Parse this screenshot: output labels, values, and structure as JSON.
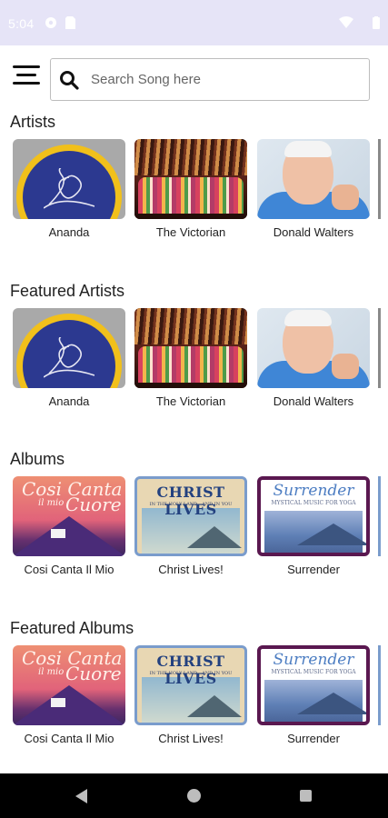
{
  "status_bar": {
    "time": "5:04",
    "icons": [
      "media-icon",
      "sim-icon",
      "wifi-icon",
      "battery-icon"
    ]
  },
  "search": {
    "placeholder": "Search Song here",
    "value": ""
  },
  "sections": {
    "artists": {
      "title": "Artists",
      "items": [
        {
          "label": "Ananda",
          "art": "ananda-logo"
        },
        {
          "label": "The Victorian",
          "art": "choir-photo"
        },
        {
          "label": "Donald Walters",
          "art": "portrait-photo"
        }
      ]
    },
    "featured_artists": {
      "title": "Featured Artists",
      "items": [
        {
          "label": "Ananda",
          "art": "ananda-logo"
        },
        {
          "label": "The Victorian",
          "art": "choir-photo"
        },
        {
          "label": "Donald Walters",
          "art": "portrait-photo"
        }
      ]
    },
    "albums": {
      "title": "Albums",
      "items": [
        {
          "label": "Cosi Canta Il Mio",
          "cover_title": "Cosi Canta",
          "cover_small": "il mio",
          "cover_word": "Cuore"
        },
        {
          "label": "Christ Lives!",
          "cover_title": "CHRIST LIVES",
          "cover_sub": "IN THE HOLY LAND—AND IN YOU"
        },
        {
          "label": "Surrender",
          "cover_title": "Surrender",
          "cover_sub": "MYSTICAL MUSIC FOR YOGA"
        }
      ]
    },
    "featured_albums": {
      "title": "Featured Albums",
      "items": [
        {
          "label": "Cosi Canta Il Mio",
          "cover_title": "Cosi Canta",
          "cover_small": "il mio",
          "cover_word": "Cuore"
        },
        {
          "label": "Christ Lives!",
          "cover_title": "CHRIST LIVES",
          "cover_sub": "IN THE HOLY LAND—AND IN YOU"
        },
        {
          "label": "Surrender",
          "cover_title": "Surrender",
          "cover_sub": "MYSTICAL MUSIC FOR YOGA"
        }
      ]
    }
  },
  "colors": {
    "status_bar": "#e6e4f7",
    "ananda_gold": "#f1c01b",
    "ananda_blue": "#2c3990",
    "nav_bar": "#000000"
  }
}
